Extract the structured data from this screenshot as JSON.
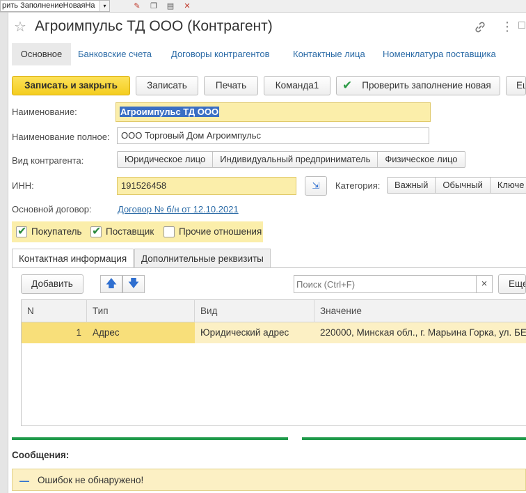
{
  "topbar": {
    "crumb_text": "рить ЗаполнениеНоваяНа",
    "dropdown_glyph": "▾"
  },
  "window": {
    "title": "Агроимпульс ТД ООО (Контрагент)"
  },
  "tabs": [
    {
      "label": "Основное"
    },
    {
      "label": "Банковские счета"
    },
    {
      "label": "Договоры контрагентов"
    },
    {
      "label": "Контактные лица"
    },
    {
      "label": "Номенклатура поставщика"
    }
  ],
  "toolbar": {
    "save_close": "Записать и закрыть",
    "save": "Записать",
    "print": "Печать",
    "command1": "Команда1",
    "check_fill": "Проверить заполнение новая",
    "more": "Ещ"
  },
  "form": {
    "name_label": "Наименование:",
    "name_value": "Агроимпульс ТД ООО",
    "fullname_label": "Наименование полное:",
    "fullname_value": "ООО Торговый Дом Агроимпульс",
    "type_label": "Вид контрагента:",
    "type_options": [
      "Юридическое лицо",
      "Индивидуальный предприниматель",
      "Физическое лицо"
    ],
    "inn_label": "ИНН:",
    "inn_value": "191526458",
    "category_label": "Категория:",
    "category_options": [
      "Важный",
      "Обычный",
      "Ключе"
    ],
    "contract_label": "Основной договор:",
    "contract_value": "Договор № б/н от 12.10.2021",
    "checkboxes": [
      {
        "label": "Покупатель",
        "checked": true
      },
      {
        "label": "Поставщик",
        "checked": true
      },
      {
        "label": "Прочие отношения",
        "checked": false
      }
    ]
  },
  "inner_tabs": [
    {
      "label": "Контактная информация"
    },
    {
      "label": "Дополнительные реквизиты"
    }
  ],
  "contacts": {
    "add_label": "Добавить",
    "search_placeholder": "Поиск (Ctrl+F)",
    "clear_glyph": "×",
    "more_label": "Еще",
    "columns": [
      "N",
      "Тип",
      "Вид",
      "Значение"
    ],
    "rows": [
      {
        "n": "1",
        "type": "Адрес",
        "kind": "Юридический адрес",
        "value": "220000, Минская обл., г. Марьина Горка, ул. БЕ"
      }
    ]
  },
  "messages": {
    "title": "Сообщения:",
    "dash": "—",
    "text": "Ошибок не обнаружено!"
  },
  "colors": {
    "accent": "#f4cd1f",
    "link": "#2a6aa6",
    "success": "#1f9a4a",
    "field_highlight": "#fbeeaa"
  }
}
